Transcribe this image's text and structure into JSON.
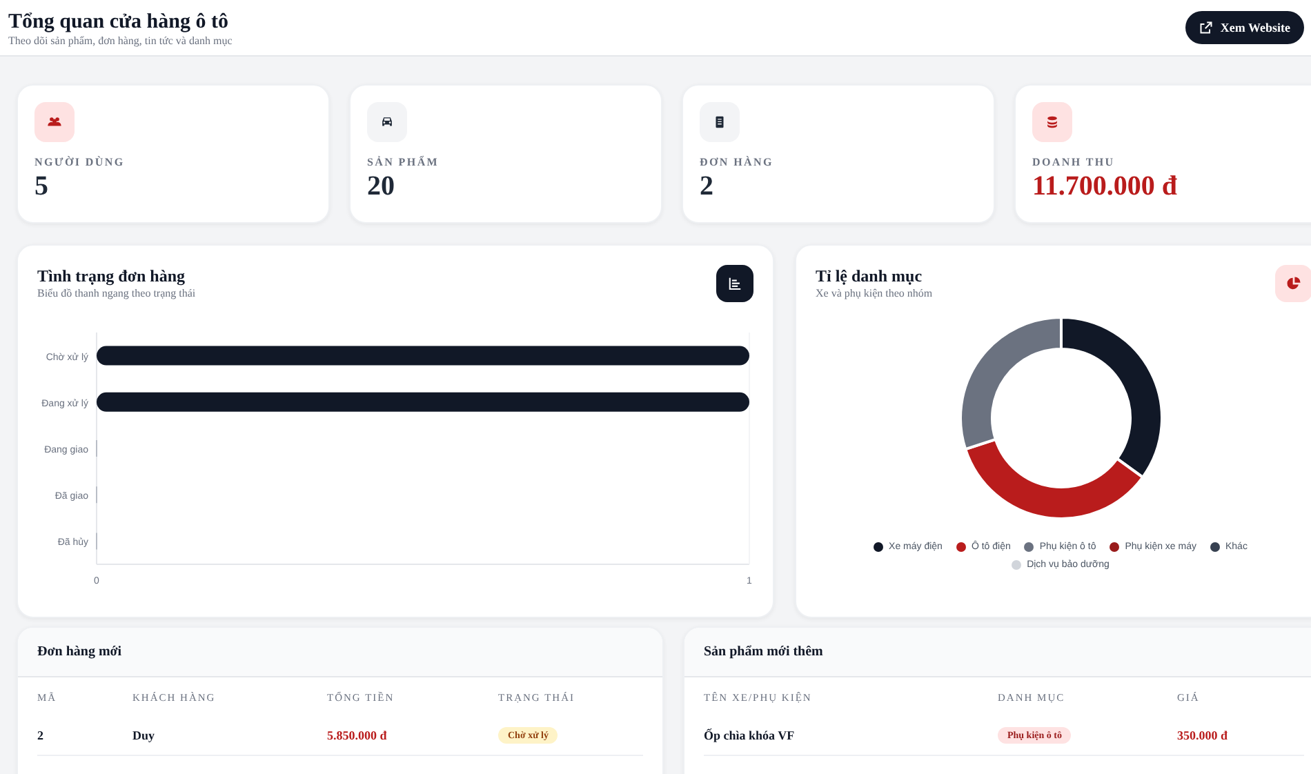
{
  "header": {
    "title": "Tổng quan cửa hàng ô tô",
    "subtitle": "Theo dõi sản phẩm, đơn hàng, tin tức và danh mục",
    "button": "Xem Website"
  },
  "stats": [
    {
      "kind": "users",
      "label": "NGƯỜI DÙNG",
      "value": "5"
    },
    {
      "kind": "car",
      "label": "SẢN PHẨM",
      "value": "20"
    },
    {
      "kind": "receipt",
      "label": "ĐƠN HÀNG",
      "value": "2"
    },
    {
      "kind": "coins",
      "label": "DOANH THU",
      "value": "11.700.000 đ"
    }
  ],
  "order_status": {
    "title": "Tình trạng đơn hàng",
    "subtitle": "Biểu đồ thanh ngang theo trạng thái",
    "chart_data": {
      "type": "bar",
      "orientation": "horizontal",
      "categories": [
        "Chờ xử lý",
        "Đang xử lý",
        "Đang giao",
        "Đã giao",
        "Đã hủy"
      ],
      "values": [
        1,
        1,
        0,
        0,
        0
      ],
      "xlim": [
        0,
        1
      ],
      "xticks": [
        0,
        1
      ]
    }
  },
  "category_share": {
    "title": "Tỉ lệ danh mục",
    "subtitle": "Xe và phụ kiện theo nhóm",
    "chart_data": {
      "type": "donut",
      "categories": [
        "Xe máy điện",
        "Ô tô điện",
        "Phụ kiện ô tô",
        "Phụ kiện xe máy",
        "Khác",
        "Dịch vụ bảo dưỡng"
      ],
      "values": [
        35,
        35,
        30,
        0,
        0,
        0
      ],
      "legend": "bottom"
    }
  },
  "new_orders": {
    "title": "Đơn hàng mới",
    "columns": [
      "MÃ",
      "KHÁCH HÀNG",
      "TỔNG TIỀN",
      "TRẠNG THÁI"
    ],
    "rows": [
      {
        "id": "2",
        "customer": "Duy",
        "total": "5.850.000 đ",
        "status": "Chờ xử lý"
      }
    ]
  },
  "new_products": {
    "title": "Sản phẩm mới thêm",
    "columns": [
      "TÊN XE/PHỤ KIỆN",
      "DANH MỤC",
      "GIÁ"
    ],
    "rows": [
      {
        "name": "Ốp chìa khóa VF",
        "category": "Phụ kiện ô tô",
        "price": "350.000 đ"
      }
    ]
  }
}
